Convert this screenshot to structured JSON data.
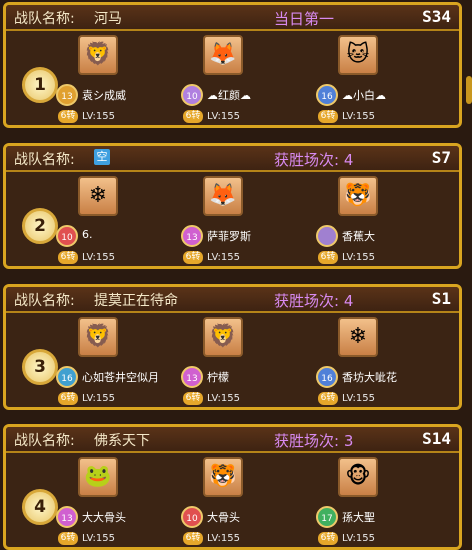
{
  "team_label": "战队名称:",
  "teams": [
    {
      "rank": "1",
      "name": "河马",
      "stat": "当日第一",
      "server": "S34",
      "members": [
        {
          "name": "袁シ成威",
          "level": "LV:155",
          "turn": "6转",
          "badge": "13",
          "badge_color": "#e0a030",
          "avatar": "🦁"
        },
        {
          "name": "☁红颜☁",
          "level": "LV:155",
          "turn": "6转",
          "badge": "10",
          "badge_color": "#b080e0",
          "avatar": "🦊"
        },
        {
          "name": "☁小白☁",
          "level": "LV:155",
          "turn": "6转",
          "badge": "16",
          "badge_color": "#5080d8",
          "avatar": "🐱"
        }
      ]
    },
    {
      "rank": "2",
      "name": "空",
      "name_is_icon": true,
      "stat": "获胜场次: 4",
      "server": "S7",
      "members": [
        {
          "name": "6.",
          "level": "LV:155",
          "turn": "6转",
          "badge": "10",
          "badge_color": "#e05050",
          "avatar": "❄"
        },
        {
          "name": "萨菲罗斯",
          "level": "LV:155",
          "turn": "6转",
          "badge": "13",
          "badge_color": "#d060d0",
          "avatar": "🦊"
        },
        {
          "name": "香蕉大",
          "level": "LV:155",
          "turn": "6转",
          "badge": "",
          "badge_color": "#a080d0",
          "avatar": "🐯"
        }
      ]
    },
    {
      "rank": "3",
      "name": "提莫正在待命",
      "stat": "获胜场次: 4",
      "server": "S1",
      "members": [
        {
          "name": "心如苍井空似月",
          "level": "LV:155",
          "turn": "6转",
          "badge": "16",
          "badge_color": "#40a0d0",
          "avatar": "🦁"
        },
        {
          "name": "柠檬",
          "level": "LV:155",
          "turn": "6转",
          "badge": "13",
          "badge_color": "#d060d0",
          "avatar": "🦁"
        },
        {
          "name": "香坊大呲花",
          "level": "LV:155",
          "turn": "6转",
          "badge": "16",
          "badge_color": "#5080d8",
          "avatar": "❄"
        }
      ]
    },
    {
      "rank": "4",
      "name": "佛系天下",
      "stat": "获胜场次: 3",
      "server": "S14",
      "members": [
        {
          "name": "大大骨头",
          "level": "LV:155",
          "turn": "6转",
          "badge": "13",
          "badge_color": "#d060d0",
          "avatar": "🐸"
        },
        {
          "name": "大骨头",
          "level": "LV:155",
          "turn": "6转",
          "badge": "10",
          "badge_color": "#e05050",
          "avatar": "🐯"
        },
        {
          "name": "孫大聖",
          "level": "LV:155",
          "turn": "6转",
          "badge": "17",
          "badge_color": "#40b060",
          "avatar": "🐵"
        }
      ]
    }
  ]
}
